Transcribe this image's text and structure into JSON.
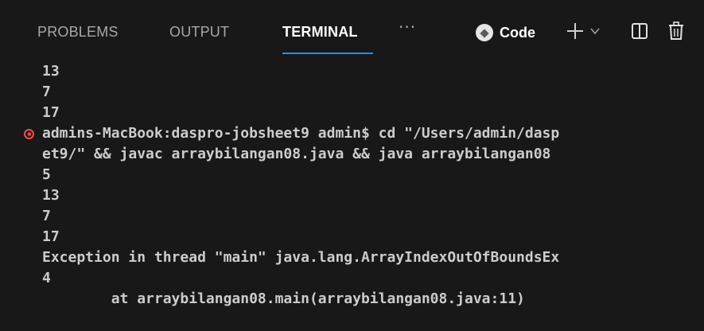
{
  "panel": {
    "tabs": [
      {
        "label": "PROBLEMS"
      },
      {
        "label": "OUTPUT"
      },
      {
        "label": "TERMINAL"
      }
    ],
    "more_label": "···",
    "launch_profile": {
      "label": "Code",
      "icon": "terminal-profile-icon"
    },
    "actions": [
      {
        "icon": "plus-icon"
      },
      {
        "icon": "chevron-down-icon"
      },
      {
        "icon": "split-terminal-icon"
      },
      {
        "icon": "trash-icon"
      }
    ]
  },
  "terminal": {
    "lines": [
      "13",
      "7",
      "17",
      "admins-MacBook:daspro-jobsheet9 admin$ cd \"/Users/admin/dasp",
      "et9/\" && javac arraybilangan08.java && java arraybilangan08",
      "5",
      "13",
      "7",
      "17",
      "Exception in thread \"main\" java.lang.ArrayIndexOutOfBoundsEx",
      "4",
      "        at arraybilangan08.main(arraybilangan08.java:11)"
    ],
    "error_marker_color": "#f14c4c"
  },
  "colors": {
    "background": "#181818",
    "text": "#cccccc",
    "active_tab_underline": "#2b8ce6"
  }
}
